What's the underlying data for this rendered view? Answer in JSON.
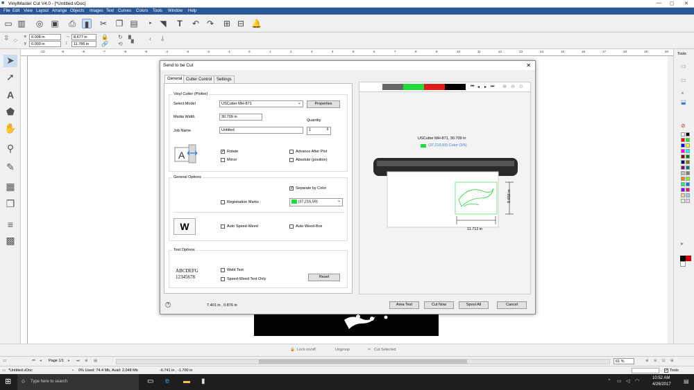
{
  "app": {
    "title": "VinylMaster Cut V4.0 - [*Untitled.vDoc]"
  },
  "menu": [
    "File",
    "Edit",
    "View",
    "Layout",
    "Arrange",
    "Objects",
    "Images",
    "Text",
    "Curves",
    "Colors",
    "Tools",
    "Window",
    "Help"
  ],
  "coords": {
    "x_label": "x",
    "y_label": "y",
    "x_value": "0.008 in",
    "y_value": "0.000 in",
    "w_value": "8.677 in",
    "h_value": "11.786 in"
  },
  "ruler_labels": [
    "-10",
    "-9",
    "-8",
    "-7",
    "-6",
    "-5",
    "-4",
    "-3",
    "-2",
    "-1",
    "0",
    "1",
    "2",
    "3",
    "4",
    "5",
    "6",
    "7",
    "8",
    "9",
    "10",
    "11",
    "12",
    "13",
    "14",
    "15",
    "16",
    "17",
    "18",
    "19",
    "20"
  ],
  "dialog": {
    "title": "Send to be Cut",
    "tabs": [
      "General",
      "Cutter Control",
      "Settings"
    ],
    "vinyl_group": "Vinyl Cutter (Plotter)",
    "select_model_label": "Select Model",
    "select_model_value": "USCutter MH-871",
    "properties_btn": "Properties",
    "media_width_label": "Media Width",
    "media_width_value": "30.709 in",
    "quantity_label": "Quantity",
    "quantity_value": "1",
    "job_name_label": "Job Name",
    "job_name_value": "Untitled",
    "rotate": "Rotate",
    "mirror": "Mirror",
    "advance_after_plot": "Advance After Plot",
    "absolute_position": "Absolute (position)",
    "general_options_group": "General Options",
    "separate_by_color": "Separate by Color",
    "registration_marks": "Registration Marks",
    "color_select_value": "(37,216,59)",
    "auto_speed_weed": "Auto Speed-Weed",
    "auto_weed_box": "Auto Weed-Box",
    "text_options_group": "Text Options",
    "font_sample_1": "ABCDEFG",
    "font_sample_2": "12345678",
    "weld_text": "Weld Text",
    "speed_weed_text_only": "Speed-Weed Text Only",
    "reset_btn": "Reset",
    "help_icon_text": "?",
    "position_readout": "7.401 in , 0.876 in",
    "area_test_btn": "Area Test",
    "cut_now_btn": "Cut Now",
    "spool_all_btn": "Spool All",
    "cancel_btn": "Cancel",
    "preview_caption": "USCutter MH-871, 30.709 in",
    "preview_color_caption": "(37,216,59) Color (3/5)",
    "preview_width": "11.712 in",
    "preview_height": "8.656 in",
    "preview_colors": [
      "#676767",
      "#25d83b",
      "#e01b1b",
      "#000000"
    ]
  },
  "bottom": {
    "lock": "Lock on/off",
    "ungroup": "Ungroup",
    "cut_selected": "Cut Selected",
    "page": "Page 1/1",
    "zoom": "61 %"
  },
  "status": {
    "file": "*Untitled.vDoc",
    "memory": "0%  Used: 74.4 Mb, Avail: 2,048 Mb",
    "cursor": "-6.741 in , -1.700 in",
    "tools_label": "Tools"
  },
  "taskbar": {
    "search_placeholder": "Type here to search",
    "time": "10:52 AM",
    "date": "4/26/2017"
  },
  "right_panel": {
    "label": "Tools"
  },
  "palette": [
    "#ffffff",
    "#000000",
    "#ff0000",
    "#00ff00",
    "#0000ff",
    "#ffff00",
    "#ff00ff",
    "#00ffff",
    "#800000",
    "#008000",
    "#000080",
    "#808000",
    "#800080",
    "#008080",
    "#c0c0c0",
    "#808080",
    "#ff8000",
    "#80ff00",
    "#00ff80",
    "#0080ff",
    "#8000ff",
    "#ff0080",
    "#ffcc99",
    "#99ccff",
    "#ccffcc",
    "#ffccff"
  ]
}
